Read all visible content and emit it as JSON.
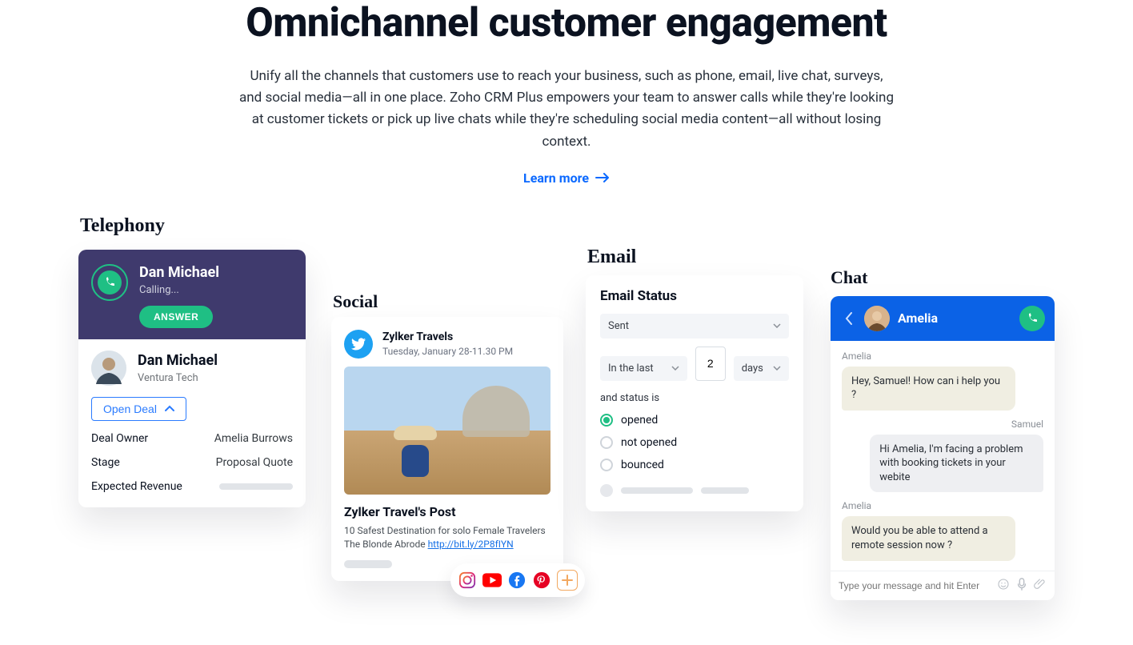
{
  "hero": {
    "title": "Omnichannel customer engagement",
    "paragraph": "Unify all the channels that customers use to reach your business, such as phone, email, live chat, surveys, and social media—all in one place. Zoho CRM Plus empowers your team to answer calls while they're looking at customer tickets or pick up live chats while they're scheduling social media content—all without losing context.",
    "learn_more": "Learn more"
  },
  "labels": {
    "telephony": "Telephony",
    "social": "Social",
    "email": "Email",
    "chat": "Chat"
  },
  "telephony": {
    "caller_name": "Dan Michael",
    "calling": "Calling...",
    "answer_label": "ANSWER",
    "contact_name": "Dan Michael",
    "company": "Ventura Tech",
    "open_deal": "Open Deal",
    "rows": {
      "deal_owner_k": "Deal Owner",
      "deal_owner_v": "Amelia Burrows",
      "stage_k": "Stage",
      "stage_v": "Proposal Quote",
      "exp_rev_k": "Expected Revenue"
    }
  },
  "social": {
    "brand": "Zylker Travels",
    "date": "Tuesday, January 28-11.30 PM",
    "post_title": "Zylker Travel's Post",
    "post_desc": "10 Safest Destination for solo Female Travelers The Blonde Abrode ",
    "post_link": "http://bit.ly/2P8fIYN",
    "icons": {
      "instagram": "instagram-icon",
      "youtube": "youtube-icon",
      "facebook": "facebook-icon",
      "pinterest": "pinterest-icon",
      "add": "add-channel-icon"
    }
  },
  "email": {
    "heading": "Email Status",
    "status_value": "Sent",
    "range_label": "In the last",
    "number_value": "2",
    "unit_label": "days",
    "and_status": "and status is",
    "options": {
      "opened": "opened",
      "not_opened": "not opened",
      "bounced": "bounced"
    }
  },
  "chat": {
    "agent_name": "Amelia",
    "threads": {
      "a1_from": "Amelia",
      "a1_msg": "Hey, Samuel! How can i help you ?",
      "s1_from": "Samuel",
      "s1_msg": "Hi Amelia, I'm facing a problem with booking tickets in your webite",
      "a2_from": "Amelia",
      "a2_msg": "Would you be able to attend a remote session now ?"
    },
    "input_placeholder": "Type your message and hit Enter"
  },
  "colors": {
    "primary_blue": "#0b62e6",
    "accent_green": "#1fbf84",
    "tele_purple": "#3f3a6d",
    "link_blue": "#1570e6"
  }
}
